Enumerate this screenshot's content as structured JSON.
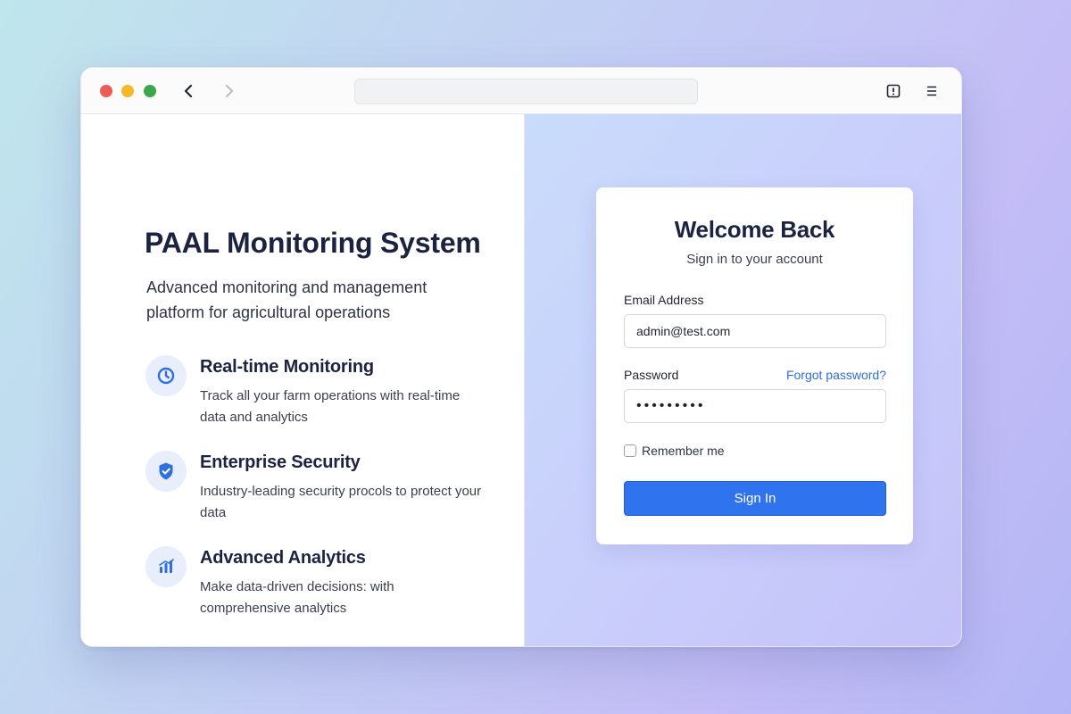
{
  "colors": {
    "accent": "#2f74ee",
    "link": "#2f6fe0",
    "heading": "#1b2340",
    "icon_bg": "#e8eefb",
    "traffic_red": "#ef5a52",
    "traffic_yellow": "#f4b829",
    "traffic_green": "#3ba64a"
  },
  "browser": {
    "icons": [
      "back-arrow-icon",
      "forward-arrow-icon",
      "info-icon",
      "menu-icon"
    ],
    "url": ""
  },
  "intro": {
    "title": "PAAL Monitoring System",
    "subtitle": "Advanced monitoring and management platform for agricultural operations"
  },
  "features": [
    {
      "icon": "clock-icon",
      "title": "Real-time Monitoring",
      "description": "Track all your farm operations with real-time data and analytics"
    },
    {
      "icon": "shield-check-icon",
      "title": "Enterprise Security",
      "description": "Industry-leading security procols to protect your data"
    },
    {
      "icon": "bar-chart-icon",
      "title": "Advanced Analytics",
      "description": "Make data-driven decisions: with comprehensive analytics"
    }
  ],
  "login": {
    "title": "Welcome Back",
    "subtitle": "Sign in to your account",
    "email_label": "Email Address",
    "email_value": "admin@test.com",
    "password_label": "Password",
    "password_value": "•••••••••",
    "forgot_label": "Forgot password?",
    "remember_label": "Remember me",
    "remember_checked": false,
    "submit_label": "Sign In"
  }
}
